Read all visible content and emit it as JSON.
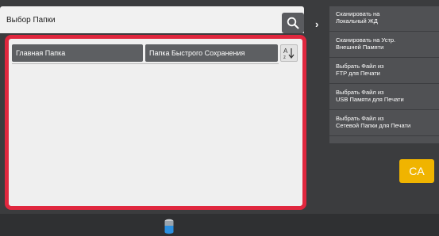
{
  "header": {
    "title": "Выбор Папки"
  },
  "panel": {
    "tabs": [
      {
        "label": "Главная Папка"
      },
      {
        "label": "Папка Быстрого Сохранения"
      }
    ],
    "sort_label": "A↓"
  },
  "menu": {
    "items": [
      {
        "line1": "Сканировать на",
        "line2": "Локальный ЖД"
      },
      {
        "line1": "Сканировать на Устр.",
        "line2": "Внешней Памяти"
      },
      {
        "line1": "Выбрать Файл из",
        "line2": "FTP для Печати"
      },
      {
        "line1": "Выбрать Файл из",
        "line2": "USB Памяти для Печати"
      },
      {
        "line1": "Выбрать Файл из",
        "line2": "Сетевой Папки для Печати"
      }
    ]
  },
  "ca_button": {
    "label": "CA"
  },
  "icons": [
    "search-icon",
    "sort-az-icon",
    "chevron-right-icon",
    "toner-icon"
  ],
  "colors": {
    "highlight": "#e0273e",
    "ca": "#f0b400"
  }
}
